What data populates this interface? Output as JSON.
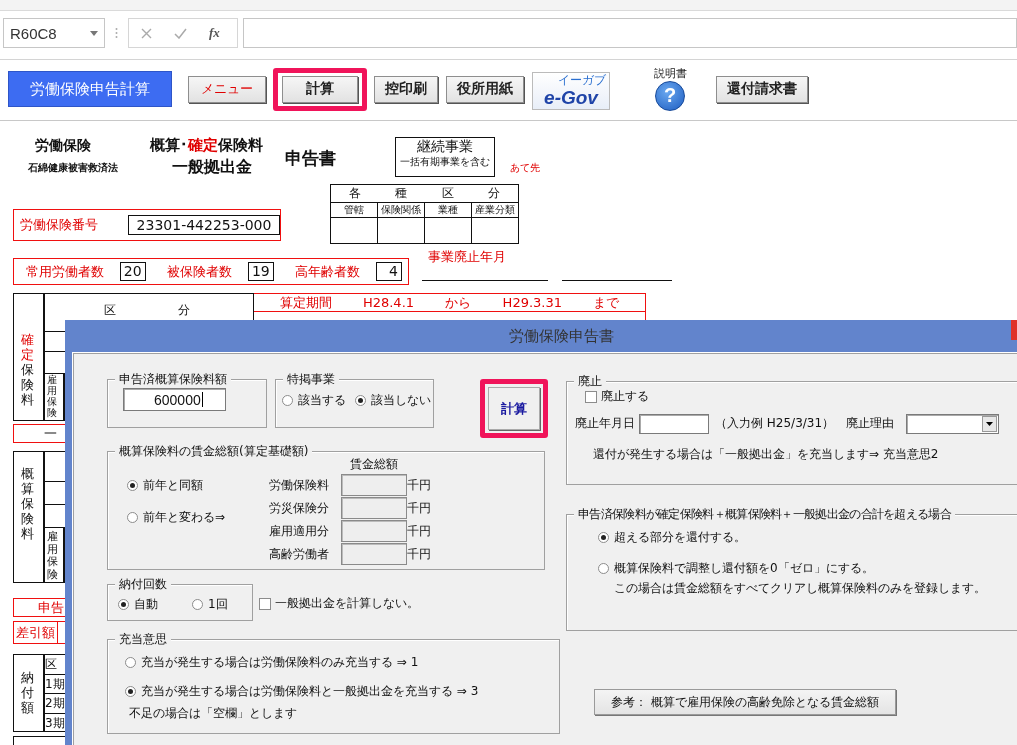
{
  "formula_bar": {
    "name_box": "R60C8",
    "function_label": "fx"
  },
  "toolbar": {
    "title_button": "労働保険申告計算",
    "buttons": [
      {
        "label": "メニュー",
        "kind": "menu",
        "highlighted": false
      },
      {
        "label": "計算",
        "kind": "plain",
        "highlighted": true
      },
      {
        "label": "控印刷",
        "kind": "plain",
        "highlighted": false
      },
      {
        "label": "役所用紙",
        "kind": "plain",
        "highlighted": false
      },
      {
        "label": "e-Gov",
        "kind": "logo",
        "sub": "イーガブ",
        "highlighted": false
      }
    ],
    "help_label": "説明書",
    "help_glyph": "?",
    "refund_button": "還付請求書"
  },
  "form": {
    "heading_left": "労働保険",
    "heading_left_sub": "石綿健康被害救済法",
    "title_line1": [
      {
        "text": "概算･",
        "highlight": false
      },
      {
        "text": "確定",
        "highlight": true
      },
      {
        "text": "保険料",
        "highlight": false
      }
    ],
    "title_line2": "一般拠出金",
    "title_suffix": "申告書",
    "business_box": {
      "main": "継続事業",
      "sub": "一括有期事業を含む"
    },
    "addressee": "あて先",
    "category_table": {
      "header": [
        "各",
        "種",
        "区",
        "分"
      ],
      "columns": [
        "管轄",
        "保険関係",
        "業種",
        "産業分類"
      ]
    },
    "insurance_number": {
      "label": "労働保険番号",
      "value": "23301-442253-000"
    },
    "counts": [
      {
        "label": "常用労働者数",
        "value": "20"
      },
      {
        "label": "被保険者数",
        "value": "19"
      },
      {
        "label": "高年齢者数",
        "value": "4"
      }
    ],
    "closure_label": "事業廃止年月",
    "period": {
      "label": "算定期間",
      "from": "H28.4.1",
      "from_word": "から",
      "to": "H29.3.31",
      "to_word": "まで"
    },
    "table_header": [
      "区",
      "分"
    ],
    "confirmed_label": [
      {
        "text": "確定",
        "highlight": true
      },
      {
        "text": "保険料",
        "highlight": false
      }
    ],
    "employment_label_1": "雇用保険",
    "confirmed_total": "一",
    "estimated_label": "概算保険料",
    "employment_label_2": "雇用保険",
    "declared_label": "申告",
    "difference_label": "差引額",
    "payment_label": "納付額",
    "payment_rows": [
      "区",
      "1期",
      "2期",
      "3期"
    ]
  },
  "dialog": {
    "title": "労働保険申告書",
    "declared_amount": {
      "legend": "申告済概算保険料額",
      "value": "600000"
    },
    "special": {
      "legend": "特掲事業",
      "options": [
        {
          "label": "該当する",
          "selected": false
        },
        {
          "label": "該当しない",
          "selected": true
        }
      ]
    },
    "calc_button": {
      "label": "計算",
      "highlighted": true
    },
    "wages": {
      "legend": "概算保険料の賃金総額(算定基礎額)",
      "options": [
        {
          "label": "前年と同額",
          "selected": true
        },
        {
          "label": "前年と変わる⇒",
          "selected": false
        }
      ],
      "column_header": "賃金総額",
      "rows": [
        {
          "label": "労働保険料",
          "unit": "千円"
        },
        {
          "label": "労災保険分",
          "unit": "千円"
        },
        {
          "label": "雇用適用分",
          "unit": "千円"
        },
        {
          "label": "高齢労働者",
          "unit": "千円"
        }
      ]
    },
    "installments": {
      "legend": "納付回数",
      "options": [
        {
          "label": "自動",
          "selected": true
        },
        {
          "label": "1回",
          "selected": false
        }
      ]
    },
    "skip_general": {
      "label": "一般拠出金を計算しない。",
      "checked": false
    },
    "appropriation": {
      "legend": "充当意思",
      "options": [
        {
          "label": "充当が発生する場合は労働保険料のみ充当する ⇒ 1",
          "selected": false
        },
        {
          "label": "充当が発生する場合は労働保険料と一般拠出金を充当する ⇒ 3",
          "selected": true
        }
      ],
      "note": "不足の場合は「空欄」とします"
    },
    "abolition": {
      "legend": "廃止",
      "checkbox": {
        "label": "廃止する",
        "checked": false
      },
      "date_label": "廃止年月日",
      "example": "（入力例  H25/3/31）",
      "reason_label": "廃止理由",
      "note": "還付が発生する場合は「一般拠出金」を充当します⇒  充当意思2"
    },
    "excess": {
      "legend": "申告済保険料が確定保険料＋概算保険料＋一般拠出金の合計を超える場合",
      "options": [
        {
          "label": "超える部分を還付する。",
          "selected": true
        },
        {
          "label": "概算保険料で調整し還付額を0「ゼロ」にする。",
          "note": "この場合は賃金総額をすべてクリアし概算保険料のみを登録します。",
          "selected": false
        }
      ]
    },
    "reference_button": "参考：  概算で雇用保険の高齢免除となる賃金総額"
  }
}
